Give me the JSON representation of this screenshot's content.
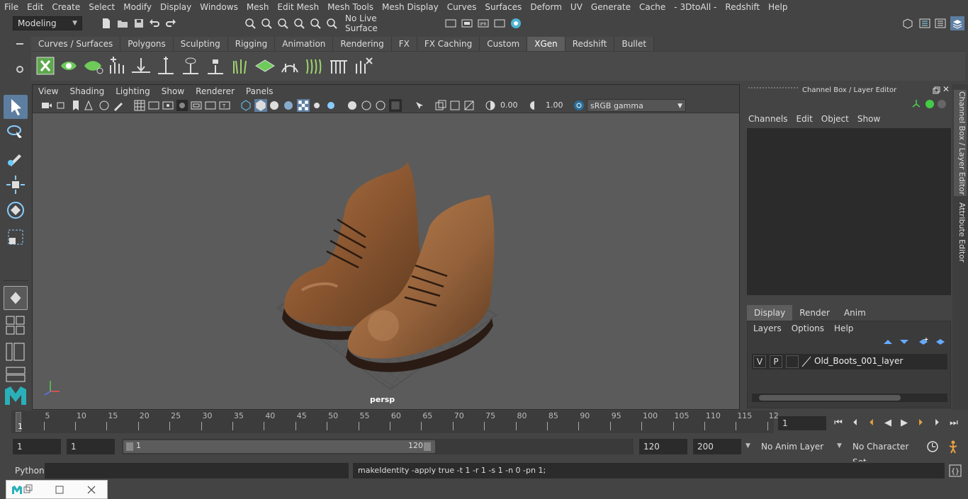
{
  "menubar": [
    "File",
    "Edit",
    "Create",
    "Select",
    "Modify",
    "Display",
    "Windows",
    "Mesh",
    "Edit Mesh",
    "Mesh Tools",
    "Mesh Display",
    "Curves",
    "Surfaces",
    "Deform",
    "UV",
    "Generate",
    "Cache",
    "- 3DtoAll -",
    "Redshift",
    "Help"
  ],
  "status": {
    "mode": "Modeling",
    "live_surface": "No Live Surface"
  },
  "shelf_tabs": [
    "Curves / Surfaces",
    "Polygons",
    "Sculpting",
    "Rigging",
    "Animation",
    "Rendering",
    "FX",
    "FX Caching",
    "Custom",
    "XGen",
    "Redshift",
    "Bullet"
  ],
  "shelf_active": "XGen",
  "viewport": {
    "menu": [
      "View",
      "Shading",
      "Lighting",
      "Show",
      "Renderer",
      "Panels"
    ],
    "exposure": "0.00",
    "gamma": "1.00",
    "colorspace": "sRGB gamma",
    "camera": "persp"
  },
  "channel_box": {
    "title": "Channel Box / Layer Editor",
    "menu": [
      "Channels",
      "Edit",
      "Object",
      "Show"
    ]
  },
  "layer_editor": {
    "tabs": [
      "Display",
      "Render",
      "Anim"
    ],
    "active_tab": "Display",
    "menu": [
      "Layers",
      "Options",
      "Help"
    ],
    "layer": {
      "v": "V",
      "p": "P",
      "name": "Old_Boots_001_layer"
    }
  },
  "side_tabs": [
    "Channel Box / Layer Editor",
    "Attribute Editor"
  ],
  "timeline": {
    "labels": [
      "5",
      "10",
      "15",
      "20",
      "25",
      "30",
      "35",
      "40",
      "45",
      "50",
      "55",
      "60",
      "65",
      "70",
      "75",
      "80",
      "85",
      "90",
      "95",
      "100",
      "105",
      "110",
      "115",
      "12"
    ],
    "start_marker": "1",
    "current_frame": "1"
  },
  "range": {
    "start": "1",
    "anim_start": "1",
    "slider_start": "1",
    "slider_end": "120",
    "end": "120",
    "anim_end": "200",
    "anim_layer": "No Anim Layer",
    "char_set": "No Character Set"
  },
  "cmd": {
    "lang": "Python",
    "output": "makeIdentity -apply true -t 1 -r 1 -s 1 -n 0 -pn 1;"
  },
  "colors": {
    "accent": "#5285a6",
    "active_tab": "#5d5d5d",
    "tool_highlight": "#5d7ea0"
  }
}
